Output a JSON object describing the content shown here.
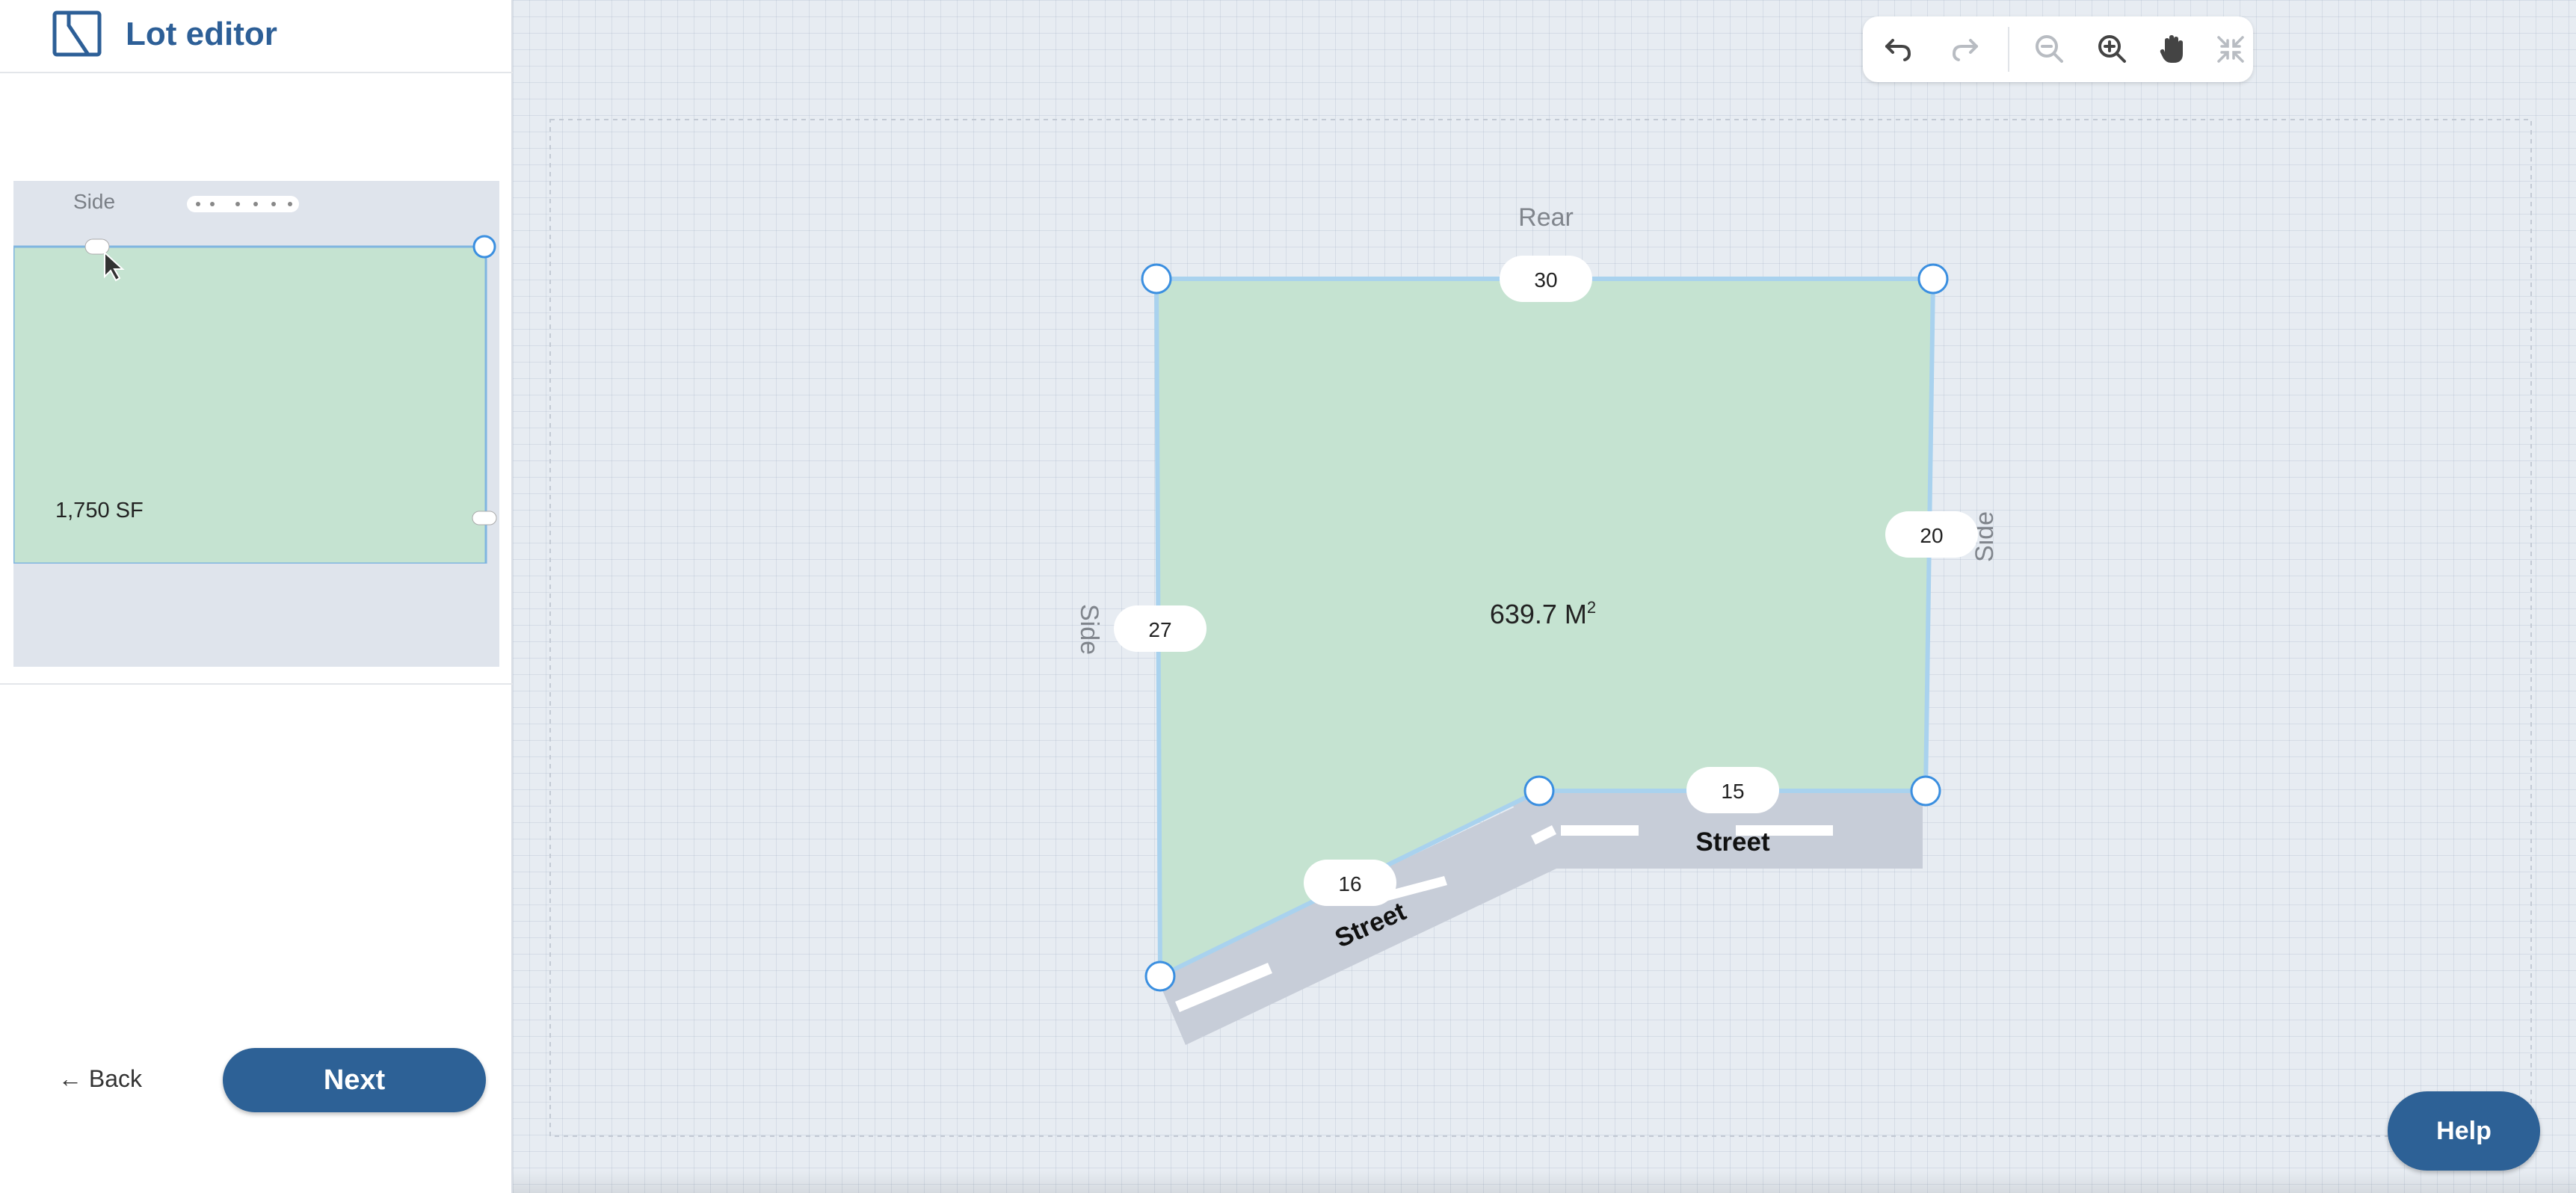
{
  "app": {
    "title": "Lot editor"
  },
  "sidebar": {
    "preview": {
      "side_label": "Side",
      "area_label": "1,750 SF"
    },
    "back_label": "← Back",
    "next_label": "Next"
  },
  "toolbar": {
    "buttons": [
      {
        "name": "undo",
        "icon": "undo-icon",
        "enabled": true
      },
      {
        "name": "redo",
        "icon": "redo-icon",
        "enabled": false
      },
      {
        "name": "zoom-out",
        "icon": "zoom-out-icon",
        "enabled": false
      },
      {
        "name": "zoom-in",
        "icon": "zoom-in-icon",
        "enabled": true
      },
      {
        "name": "pan",
        "icon": "hand-icon",
        "enabled": true
      },
      {
        "name": "fit",
        "icon": "fit-screen-icon",
        "enabled": false
      }
    ]
  },
  "lot": {
    "area_value": "639.7 M",
    "area_exp": "2",
    "edges": {
      "rear": {
        "label": "Rear",
        "length": "30"
      },
      "right_side": {
        "label": "Side",
        "length": "20"
      },
      "left_side": {
        "label": "Side",
        "length": "27"
      },
      "front_street": {
        "label": "Street",
        "length": "15"
      },
      "angled_street": {
        "label": "Street",
        "length": "16"
      }
    }
  },
  "help_label": "Help",
  "colors": {
    "accent": "#2d6196",
    "lot_fill": "#c5e3d1",
    "vertex_stroke": "#3b8fe0",
    "street_fill": "#c7cdd8",
    "canvas_bg": "#e7ecf2"
  }
}
